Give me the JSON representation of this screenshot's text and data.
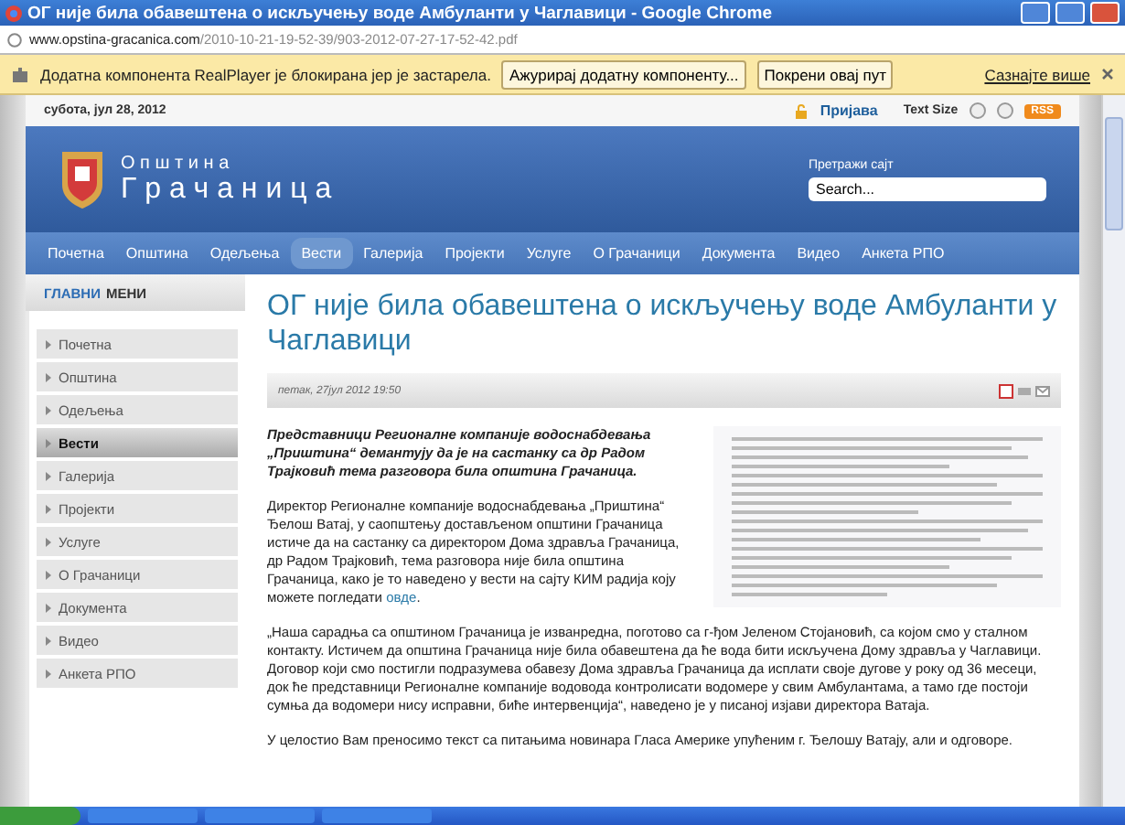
{
  "window": {
    "title": "ОГ није била обавештена о искључењу воде Амбуланти у Чаглавици - Google Chrome"
  },
  "address_bar": {
    "host": "www.opstina-gracanica.com",
    "path": "/2010-10-21-19-52-39/903-2012-07-27-17-52-42.pdf"
  },
  "infobar": {
    "message": "Додатна компонента RealPlayer је блокирана јер је застарела.",
    "buttons": [
      "Ажурирај додатну компоненту...",
      "Покрени овај пут"
    ],
    "link": "Сазнајте више"
  },
  "top_strip": {
    "date": "субота, јул 28, 2012",
    "login": "Пријава",
    "text_size": "Text Size",
    "rss": "RSS"
  },
  "header": {
    "logo_top": "О п ш т и н а",
    "logo_bottom": "Г р а ч а н и ц а",
    "search_label": "Претражи сајт",
    "search_value": "Search..."
  },
  "nav": [
    {
      "label": "Почетна",
      "selected": false
    },
    {
      "label": "Општина",
      "selected": false
    },
    {
      "label": "Одељења",
      "selected": false
    },
    {
      "label": "Вести",
      "selected": true
    },
    {
      "label": "Галерија",
      "selected": false
    },
    {
      "label": "Пројекти",
      "selected": false
    },
    {
      "label": "Услуге",
      "selected": false
    },
    {
      "label": "О Грачаници",
      "selected": false
    },
    {
      "label": "Документа",
      "selected": false
    },
    {
      "label": "Видео",
      "selected": false
    },
    {
      "label": "Анкета РПО",
      "selected": false
    }
  ],
  "sidebar": {
    "title_accent": "ГЛАВНИ",
    "title_rest": "МЕНИ",
    "items": [
      {
        "label": "Почетна",
        "selected": false
      },
      {
        "label": "Општина",
        "selected": false
      },
      {
        "label": "Одељења",
        "selected": false
      },
      {
        "label": "Вести",
        "selected": true
      },
      {
        "label": "Галерија",
        "selected": false
      },
      {
        "label": "Пројекти",
        "selected": false
      },
      {
        "label": "Услуге",
        "selected": false
      },
      {
        "label": "О Грачаници",
        "selected": false
      },
      {
        "label": "Документа",
        "selected": false
      },
      {
        "label": "Видео",
        "selected": false
      },
      {
        "label": "Анкета РПО",
        "selected": false
      }
    ]
  },
  "article": {
    "title": "ОГ није била обавештена о искључењу воде Амбуланти у Чаглавици",
    "date": "петак, 27јул 2012 19:50",
    "lead": "Представници Регионалне компаније водоснабдевања „Приштина“ демантују да је на састанку са др Радом Трајковић тема разговора била општина Грачаница.",
    "p1": "Директор Регионалне компаније водоснабдевања „Приштина“ Ђелош Ватај, у саопштењу достављеном општини Грачаница истиче да на састанку са директором Дома здравља Грачаница, др Радом Трајковић, тема разговора није била општина Грачаница, како је то наведено у вести на сајту КИМ радија коју можете погледати",
    "p1_link": "овде",
    "p1_end": ".",
    "p2": "„Наша сарадња са општином Грачаница је изванредна, поготово са г-ђом Јеленом Стојановић, са којом смо у сталном контакту. Истичем да општина Грачаница није била обавештена да ће вода бити искључена Дому здравља у Чаглавици. Договор који смо постигли подразумева обавезу Дома здравља Грачаница да исплати своје дугове у року од 36 месеци, док ће представници Регионалне компаније водовода контролисати водомере у свим Амбулантама, а тамо где постоји сумња да водомери нису исправни, биће интервенција“, наведено је у писаној изјави директора Ватаја.",
    "p3": "У целостио Вам преносимо текст са питањима новинара Гласа Америке упућеним г. Ђелошу Ватају, али и одговоре."
  }
}
